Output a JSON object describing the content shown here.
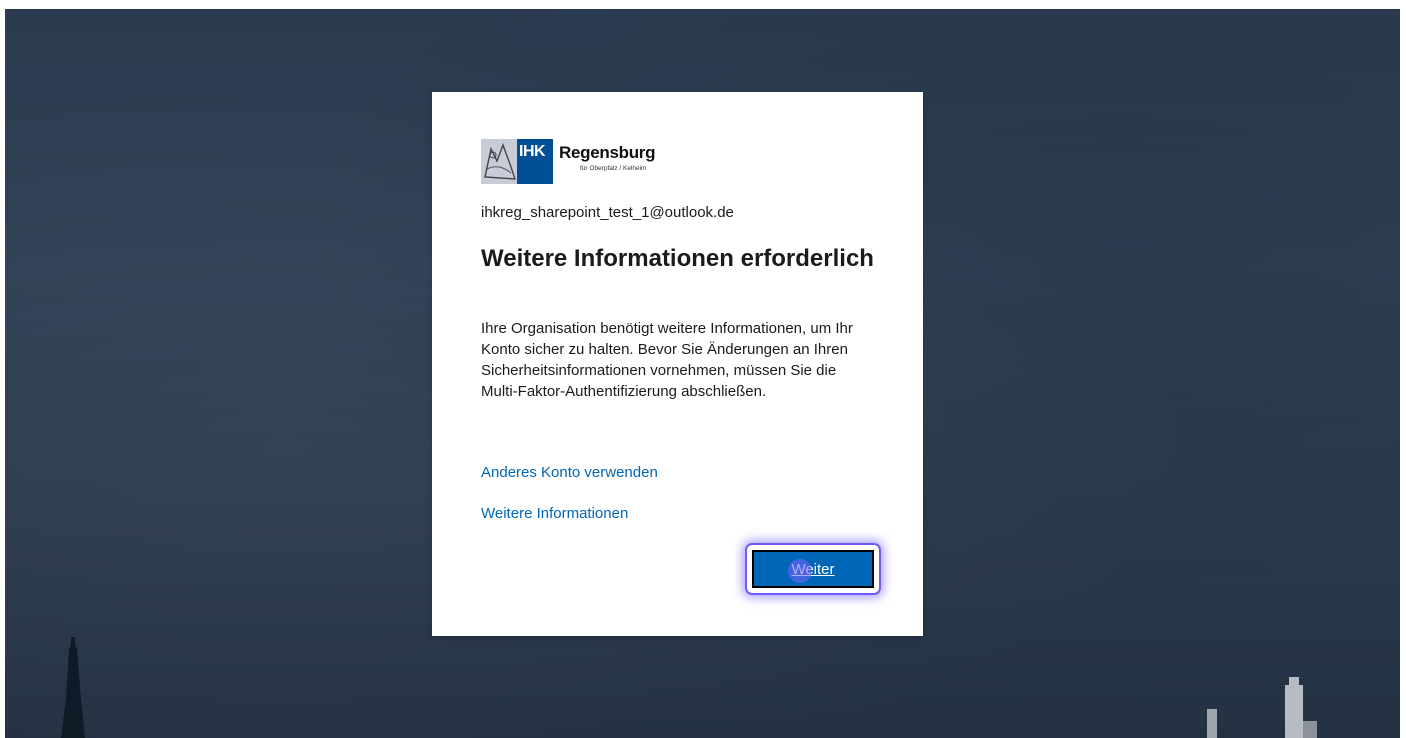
{
  "logo": {
    "org_short": "IHK",
    "city": "Regensburg",
    "subtitle": "für Oberpfalz / Kelheim"
  },
  "account": {
    "email": "ihkreg_sharepoint_test_1@outlook.de"
  },
  "dialog": {
    "title": "Weitere Informationen erforderlich",
    "description": "Ihre Organisation benötigt weitere Informationen, um Ihr Konto sicher zu halten. Bevor Sie Änderungen an Ihren Sicherheitsinformationen vornehmen, müssen Sie die Multi-Faktor-Authentifizierung abschließen.",
    "link_other_account": "Anderes Konto verwenden",
    "link_more_info": "Weitere Informationen",
    "next_button": "Weiter"
  },
  "colors": {
    "background": "#2e3e54",
    "link": "#0067b8",
    "button": "#0067b8",
    "focus_ring": "#6b5cff"
  }
}
